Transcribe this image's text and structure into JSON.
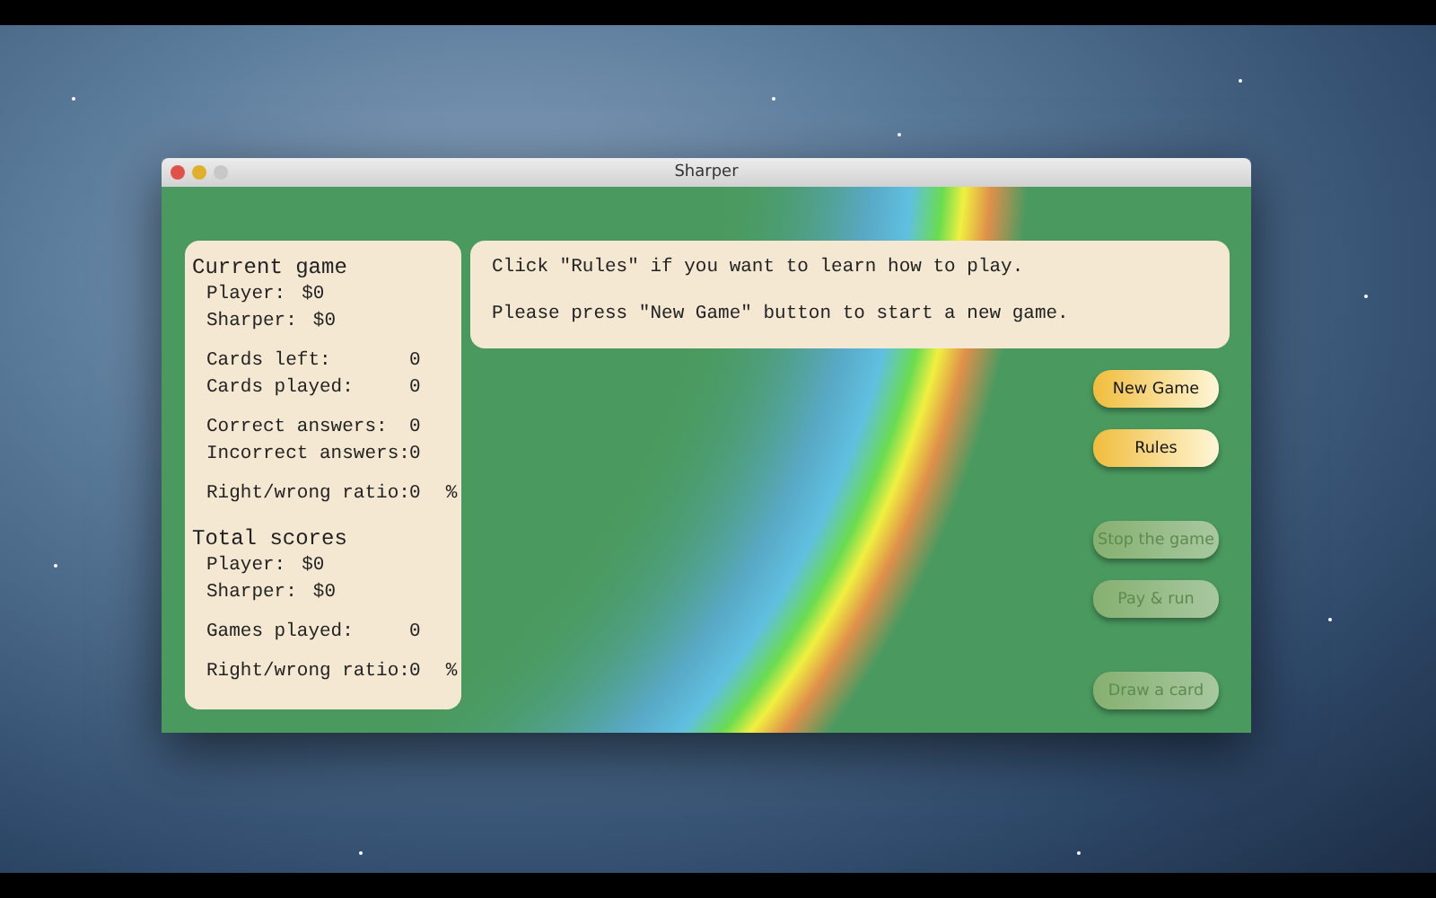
{
  "window": {
    "title": "Sharper"
  },
  "stats_panel": {
    "sections": [
      {
        "heading": "Current game",
        "groups": [
          [
            {
              "kind": "money",
              "label": "Player:",
              "value": "$0"
            },
            {
              "kind": "money",
              "label": "Sharper:",
              "value": "$0"
            }
          ],
          [
            {
              "kind": "stat",
              "label": "Cards left:",
              "value": "0"
            },
            {
              "kind": "stat",
              "label": "Cards played:",
              "value": "0"
            }
          ],
          [
            {
              "kind": "stat",
              "label": "Correct answers:",
              "value": "0"
            },
            {
              "kind": "stat",
              "label": "Incorrect answers:",
              "value": "0"
            }
          ],
          [
            {
              "kind": "stat",
              "label": "Right/wrong ratio:",
              "value": "0",
              "unit": "%"
            }
          ]
        ]
      },
      {
        "heading": "Total scores",
        "groups": [
          [
            {
              "kind": "money",
              "label": "Player:",
              "value": "$0"
            },
            {
              "kind": "money",
              "label": "Sharper:",
              "value": "$0"
            }
          ],
          [
            {
              "kind": "stat",
              "label": "Games played:",
              "value": "0"
            }
          ],
          [
            {
              "kind": "stat",
              "label": "Right/wrong ratio:",
              "value": "0",
              "unit": "%"
            }
          ]
        ]
      }
    ]
  },
  "message": [
    "Click \"Rules\" if you want to learn how to play.",
    "Please press \"New Game\" button to start a new game."
  ],
  "button_groups": [
    [
      {
        "label": "New Game",
        "disabled": false
      },
      {
        "label": "Rules",
        "disabled": false
      }
    ],
    [
      {
        "label": "Stop the game",
        "disabled": true
      },
      {
        "label": "Pay & run",
        "disabled": true
      }
    ],
    [
      {
        "label": "Draw a card",
        "disabled": true
      }
    ]
  ]
}
